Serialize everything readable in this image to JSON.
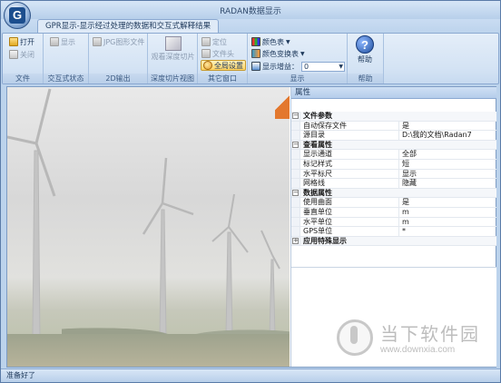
{
  "window": {
    "title": "RADAN数据显示",
    "app_button_label": "G"
  },
  "ribbon_tab": "GPR显示-显示经过处理的数据和交互式解释结果",
  "groups": {
    "file": {
      "label": "文件",
      "open": "打开",
      "close": "关闭"
    },
    "interactive": {
      "label": "交互式状态",
      "show": "显示"
    },
    "output2d": {
      "label": "2D输出",
      "jpg": "JPG图形文件"
    },
    "depth": {
      "label": "深度切片视图",
      "view": "观看深度切片"
    },
    "other": {
      "label": "其它窗口",
      "locate": "定位",
      "file_head": "文件头",
      "global_settings": "全局设置"
    },
    "display": {
      "label": "显示",
      "color_table": "颜色表",
      "color_transform": "颜色变换表",
      "gain_label": "显示增益：",
      "gain_value": "0"
    },
    "help": {
      "label": "帮助",
      "button": "帮助"
    }
  },
  "properties": {
    "header": "属性",
    "categories": [
      {
        "name": "文件参数",
        "items": [
          {
            "key": "自动保存文件",
            "value": "是"
          },
          {
            "key": "源目录",
            "value": "D:\\我的文档\\Radan7"
          }
        ]
      },
      {
        "name": "查看属性",
        "items": [
          {
            "key": "显示通道",
            "value": "全部"
          },
          {
            "key": "标记样式",
            "value": "短"
          },
          {
            "key": "水平标尺",
            "value": "显示"
          },
          {
            "key": "网格线",
            "value": "隐藏"
          }
        ]
      },
      {
        "name": "数据属性",
        "items": [
          {
            "key": "使用曲面",
            "value": "是"
          },
          {
            "key": "垂直单位",
            "value": "m"
          },
          {
            "key": "水平单位",
            "value": "m"
          },
          {
            "key": "GPS单位",
            "value": "*"
          }
        ]
      },
      {
        "name": "应用特殊显示",
        "items": []
      }
    ]
  },
  "status": "准备好了",
  "watermark": {
    "title": "当下软件园",
    "url": "www.downxia.com"
  },
  "icons": {
    "app": "gpr-app-icon",
    "help": "help-icon"
  }
}
